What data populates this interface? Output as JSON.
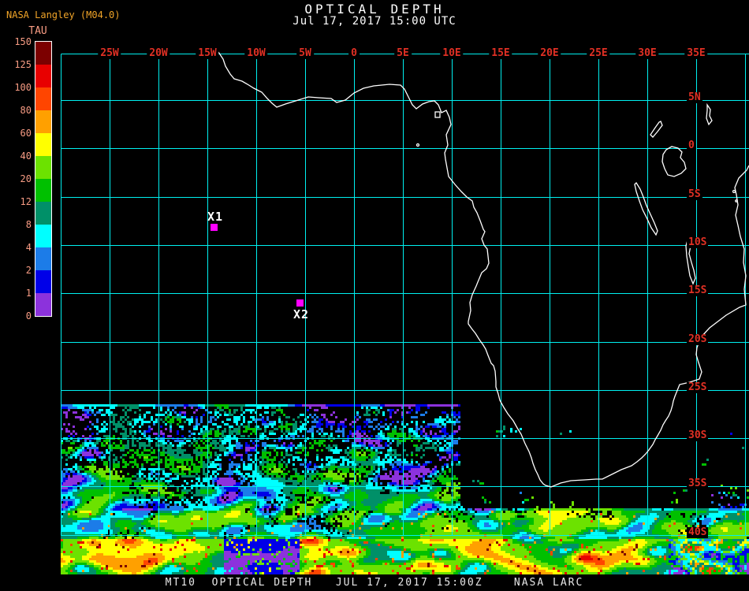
{
  "header": {
    "source_label": "NASA Langley (M04.0)",
    "title": "OPTICAL DEPTH",
    "subtitle": "Jul 17, 2017 15:00 UTC"
  },
  "colorbar": {
    "label": "TAU",
    "tick_values": [
      "150",
      "125",
      "100",
      "80",
      "60",
      "40",
      "20",
      "12",
      "8",
      "4",
      "2",
      "1",
      "0"
    ],
    "segments_top_to_bottom": [
      {
        "range": "125-150",
        "color": "#7C0000"
      },
      {
        "range": "100-125",
        "color": "#E80000"
      },
      {
        "range": "80-100",
        "color": "#FF4500"
      },
      {
        "range": "60-80",
        "color": "#FFA000"
      },
      {
        "range": "40-60",
        "color": "#FFFF00"
      },
      {
        "range": "20-40",
        "color": "#6CE200"
      },
      {
        "range": "12-20",
        "color": "#00C000"
      },
      {
        "range": "8-12",
        "color": "#009068"
      },
      {
        "range": "4-8",
        "color": "#00FFFF"
      },
      {
        "range": "2-4",
        "color": "#1C7CE8"
      },
      {
        "range": "1-2",
        "color": "#0000E8"
      },
      {
        "range": "0-1",
        "color": "#8C32DC"
      }
    ]
  },
  "map": {
    "grid_color": "#00F0F0",
    "label_color": "#E03024",
    "coastline_color": "#FFFFFF",
    "lon_labels": [
      "25W",
      "20W",
      "15W",
      "10W",
      "5W",
      "0",
      "5E",
      "10E",
      "15E",
      "20E",
      "25E",
      "30E",
      "35E"
    ],
    "lat_labels": [
      "5N",
      "0",
      "5S",
      "10S",
      "15S",
      "20S",
      "25S",
      "30S",
      "35S",
      "40S"
    ],
    "markers": [
      {
        "label": "X1",
        "color": "#FF00FF"
      },
      {
        "label": "X2",
        "color": "#FF00FF"
      }
    ]
  },
  "footer": {
    "text": "MT10  OPTICAL DEPTH   JUL 17, 2017 15:00Z    NASA LARC"
  }
}
